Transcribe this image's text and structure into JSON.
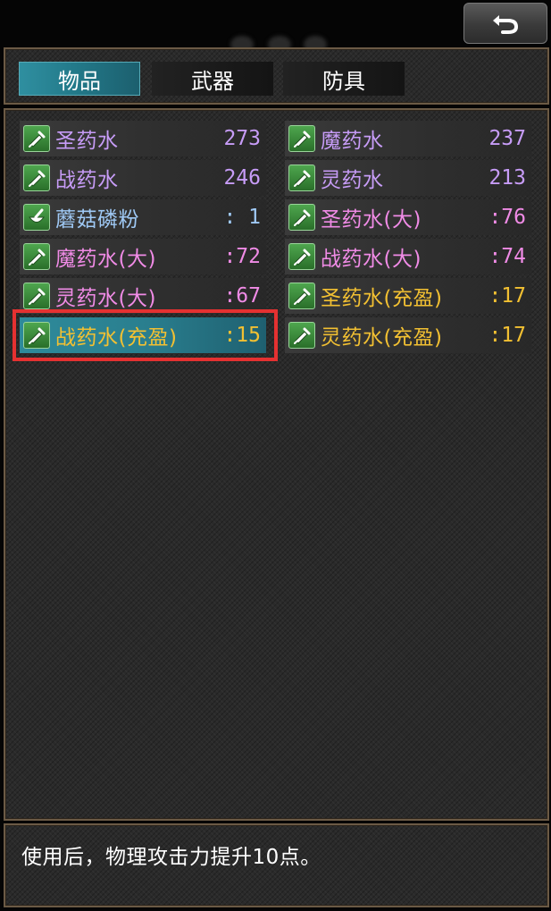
{
  "tabs": [
    {
      "label": "物品",
      "active": true
    },
    {
      "label": "武器",
      "active": false
    },
    {
      "label": "防具",
      "active": false
    }
  ],
  "items_left": [
    {
      "name": "圣药水",
      "count": "273",
      "color": "#c79cf7",
      "icon": "potion-icon"
    },
    {
      "name": "战药水",
      "count": "246",
      "color": "#c79cf7",
      "icon": "potion-icon"
    },
    {
      "name": "蘑菇磷粉",
      "count": ": 1",
      "color": "#9fc9f5",
      "icon": "mortar-icon"
    },
    {
      "name": "魔药水(大)",
      "count": ":72",
      "color": "#f08be6",
      "icon": "potion-icon"
    },
    {
      "name": "灵药水(大)",
      "count": ":67",
      "color": "#f08be6",
      "icon": "potion-icon"
    },
    {
      "name": "战药水(充盈)",
      "count": ":15",
      "color": "#f2c032",
      "icon": "potion-icon",
      "selected": true
    }
  ],
  "items_right": [
    {
      "name": "魔药水",
      "count": "237",
      "color": "#c79cf7",
      "icon": "potion-icon"
    },
    {
      "name": "灵药水",
      "count": "213",
      "color": "#c79cf7",
      "icon": "potion-icon"
    },
    {
      "name": "圣药水(大)",
      "count": ":76",
      "color": "#f08be6",
      "icon": "potion-icon"
    },
    {
      "name": "战药水(大)",
      "count": ":74",
      "color": "#f08be6",
      "icon": "potion-icon"
    },
    {
      "name": "圣药水(充盈)",
      "count": ":17",
      "color": "#f2c032",
      "icon": "potion-icon"
    },
    {
      "name": "灵药水(充盈)",
      "count": ":17",
      "color": "#f2c032",
      "icon": "potion-icon"
    }
  ],
  "description": "使用后，物理攻击力提升10点。",
  "colors": {
    "accent": "#2e8a9a",
    "highlight": "#e53131",
    "frame": "#6b5a45"
  }
}
